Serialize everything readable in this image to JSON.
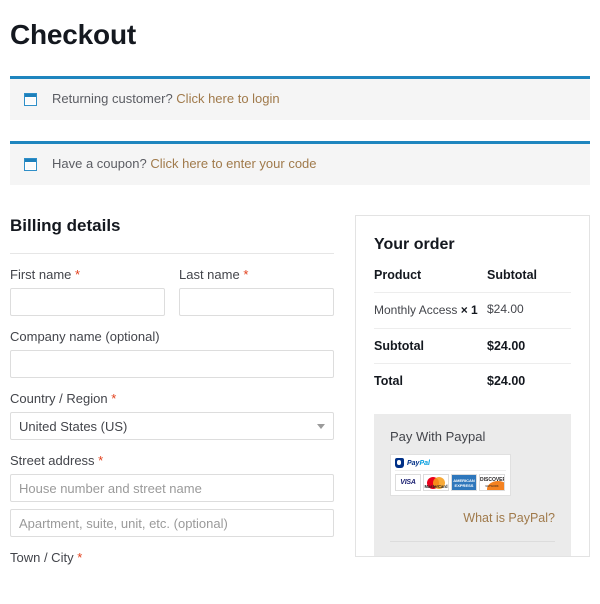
{
  "page": {
    "title": "Checkout"
  },
  "notices": [
    {
      "icon": "window-info-icon",
      "text": "Returning customer?",
      "link": "Click here to login"
    },
    {
      "icon": "window-info-icon",
      "text": "Have a coupon?",
      "link": "Click here to enter your code"
    }
  ],
  "billing": {
    "heading": "Billing details",
    "required_mark": "*",
    "first_name": {
      "label": "First name",
      "value": "",
      "placeholder": "",
      "required": true
    },
    "last_name": {
      "label": "Last name",
      "value": "",
      "placeholder": "",
      "required": true
    },
    "company": {
      "label": "Company name (optional)",
      "value": "",
      "placeholder": "",
      "required": false
    },
    "country": {
      "label": "Country / Region",
      "value": "United States (US)",
      "required": true
    },
    "street": {
      "label": "Street address",
      "required": true,
      "line1_placeholder": "House number and street name",
      "line1_value": "",
      "line2_placeholder": "Apartment, suite, unit, etc. (optional)",
      "line2_value": ""
    },
    "city": {
      "label": "Town / City",
      "required": true
    }
  },
  "order": {
    "heading": "Your order",
    "columns": {
      "product": "Product",
      "subtotal": "Subtotal"
    },
    "items": [
      {
        "name": "Monthly Access",
        "qty": "× 1",
        "amount": "$24.00"
      }
    ],
    "totals": [
      {
        "label": "Subtotal",
        "amount": "$24.00"
      },
      {
        "label": "Total",
        "amount": "$24.00"
      }
    ]
  },
  "payment": {
    "method_label": "Pay With Paypal",
    "cards_alt": "paypal-cards-logos",
    "cards": [
      "VISA",
      "MasterCard",
      "American Express",
      "Discover"
    ],
    "paypal_word_a": "Pay",
    "paypal_word_b": "Pal",
    "visa_text": "VISA",
    "mastercard_text": "MasterCard",
    "amex_line1": "AMERICAN",
    "amex_line2": "EXPRESS",
    "discover_text": "DISCOVER",
    "discover_sub": "NETWORK",
    "what_is_paypal": "What is PayPal?"
  },
  "colors": {
    "accent_blue": "#1e85be",
    "link_bronze": "#a07a4b",
    "required_red": "#e2401c",
    "notice_bg": "#f5f5f5",
    "payment_bg": "#ebebeb",
    "text": "#43454b",
    "heading": "#14181f"
  }
}
